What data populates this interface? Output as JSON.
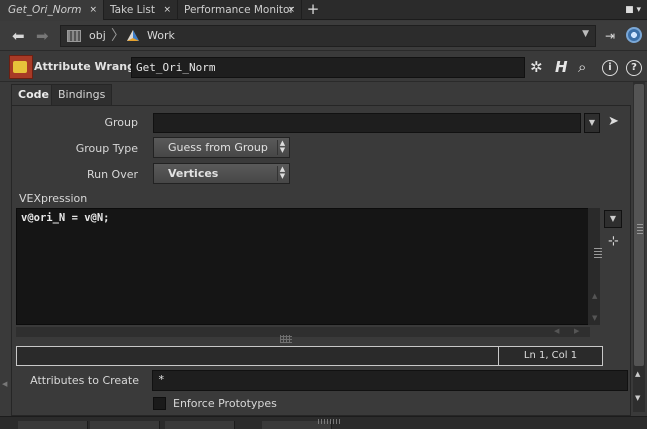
{
  "tabs": {
    "items": [
      {
        "label": "Get_Ori_Norm"
      },
      {
        "label": "Take List"
      },
      {
        "label": "Performance Monitor"
      }
    ],
    "close_glyph": "×",
    "add_glyph": "+",
    "menu_glyph": "■ ▾"
  },
  "path": {
    "back_glyph": "⬅",
    "forward_glyph": "➡",
    "segments": [
      "obj",
      "Work"
    ],
    "separator": "〉",
    "dropdown_glyph": "▼"
  },
  "node": {
    "type_label": "Attribute Wrangle",
    "name": "Get_Ori_Norm",
    "icons": [
      "gear-icon",
      "help-h-icon",
      "search-icon",
      "info-icon",
      "question-icon"
    ],
    "gear_glyph": "✲",
    "h_glyph": "H",
    "search_glyph": "⌕",
    "info_glyph": "i",
    "question_glyph": "?"
  },
  "subtabs": {
    "code": "Code",
    "bindings": "Bindings"
  },
  "parms": {
    "group_label": "Group",
    "group_value": "",
    "group_type_label": "Group Type",
    "group_type_value": "Guess from Group",
    "run_over_label": "Run Over",
    "run_over_value": "Vertices",
    "vexpression_label": "VEXpression",
    "code": "v@ori_N = v@N;",
    "cursor_status": "Ln 1, Col 1",
    "attributes_label": "Attributes to Create",
    "attributes_value": "*",
    "enforce_prototypes_label": "Enforce Prototypes",
    "enforce_prototypes_checked": false
  },
  "colors": {
    "background": "#3a3a3a",
    "field_background": "#1e1e1e",
    "wrangle_icon": "#a83a26"
  }
}
